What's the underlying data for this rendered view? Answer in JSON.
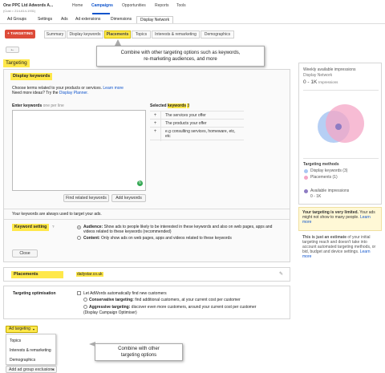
{
  "account": {
    "name": "One PPC Ltd Adwords A...",
    "id": "(Cust = 214-614-1931)"
  },
  "topnav": {
    "items": [
      "Home",
      "Campaigns",
      "Opportunities",
      "Reports",
      "Tools"
    ]
  },
  "subtabs": {
    "items": [
      "Ad Groups",
      "Settings",
      "Ads",
      "Ad extensions",
      "Dimensions",
      "Display Network"
    ]
  },
  "targeting_button": "+ TARGETING",
  "display_tabs": [
    "Summary",
    "Display keywords",
    "Placements",
    "Topics",
    "Interests & remarketing",
    "Demographics"
  ],
  "callout_top": {
    "line1": "Combine with other targeting options such as keywords,",
    "line2": "re-marketing audiences, and more"
  },
  "back_arrow": "←",
  "targeting_heading": "Targeting",
  "display_keywords": {
    "title": "Display keywords",
    "desc": "Choose terms related to your products or services.",
    "learn_more": "Learn more",
    "ideas": "Need more ideas? Try the",
    "planner": "Display Planner.",
    "enter_label": "Enter keywords",
    "enter_hint": "one per line",
    "selected_label": "Selected",
    "selected_keyword": "keywords",
    "selected_count": "3",
    "selected_items": [
      "The services your offer",
      "The products your offer",
      "e.g consulting services, homeware, etc, etc"
    ],
    "find_button": "Find related keywords",
    "add_button": "Add keywords",
    "always_text": "Your keywords are always used to target your ads."
  },
  "keyword_setting": {
    "label": "Keyword setting",
    "help": "?",
    "audience_bold": "Audience:",
    "audience_text": "Show ads to people likely to be interested in these keywords and also on web pages, apps and videos related to these keywords (recommended)",
    "content_bold": "Content:",
    "content_text": "Only show ads on web pages, apps and videos related to these keywords",
    "close": "Close"
  },
  "placements": {
    "label": "Placements",
    "value": "dailystar.co.uk"
  },
  "optimisation": {
    "label": "Targeting optimisation",
    "checkbox": "Let AdWords automatically find new customers",
    "conservative_bold": "Conservative targeting:",
    "conservative_text": "find additional customers, at your current cost per customer",
    "aggressive_bold": "Aggressive targeting:",
    "aggressive_text": "discover even more customers, around your current cost per customer",
    "aggressive_note": "(Display Campaign Optimiser)"
  },
  "ad_targeting": {
    "label": "Ad targeting",
    "items": [
      "Topics",
      "Interests & remarketing",
      "Demographics"
    ]
  },
  "callout_bottom": {
    "line1": "Combine with other",
    "line2": "targeting options"
  },
  "exclusions_button": "Add ad group exclusions",
  "sidebar": {
    "weekly_label": "Weekly available impressions",
    "network": "Display Network",
    "range": "0 - 1K",
    "range_unit": "Impressions",
    "methods_title": "Targeting methods",
    "methods": [
      "Display keywords (3)",
      "Placements (1)"
    ],
    "available_label": "Available impressions",
    "available_value": "0 - 1K",
    "limited_bold": "Your targeting is very limited.",
    "limited_text": "Your ads might not show to many people.",
    "limited_link": "Learn more",
    "estimate_bold": "This is just an estimate",
    "estimate_text": "of your initial targeting reach and doesn't take into account automated targeting methods, or bid, budget and device settings.",
    "estimate_link": "Learn more"
  },
  "colors": {
    "red": "#dd4b39",
    "blue": "#1155cc",
    "yellow": "#ffe84a",
    "venn_blue": "#a9c7f2",
    "venn_pink": "#f4a6c6",
    "venn_purple": "#8e7cc3"
  }
}
